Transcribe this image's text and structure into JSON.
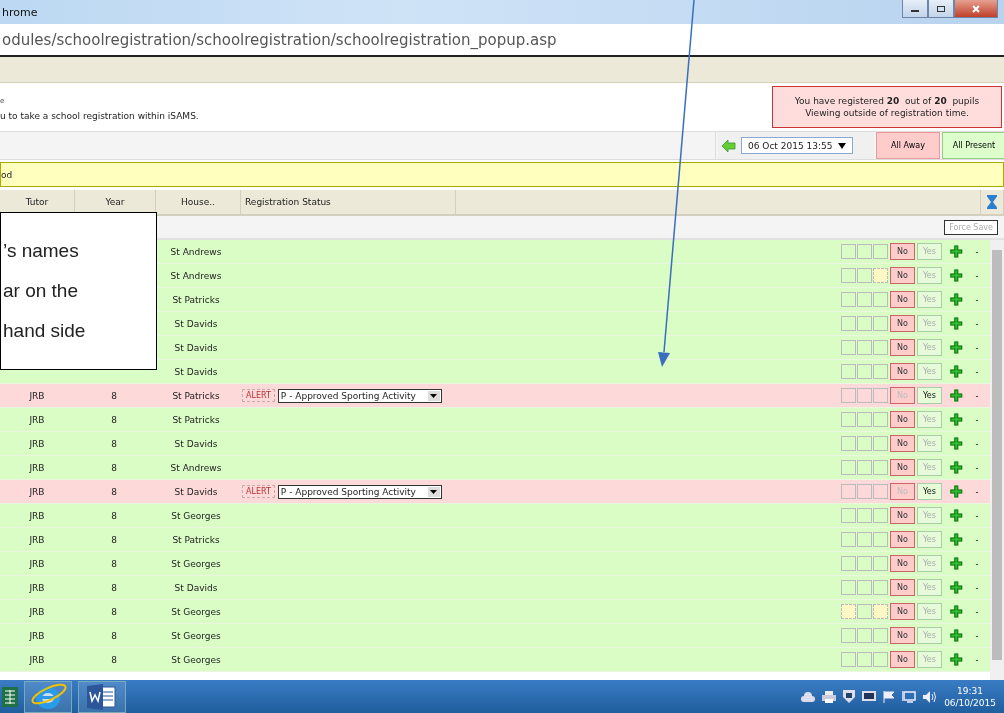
{
  "window": {
    "title": "hrome"
  },
  "address_bar": {
    "url": "odules/schoolregistration/schoolregistration/schoolregistration_popup.asp"
  },
  "intro": {
    "line_1": "e",
    "line_2": "u to take a school registration within iSAMS."
  },
  "notice": {
    "line_1": "You have registered **20**  out of **20**  pupils",
    "line_2": "Viewing outside of registration time."
  },
  "filter": {
    "date": "06 Oct 2015 13:55",
    "all_away": "All Away",
    "all_present": "All Present"
  },
  "info_bar": {
    "text": "od"
  },
  "table": {
    "columns": [
      "Tutor",
      "Year",
      "House..",
      "Registration Status"
    ],
    "force_save": "Force Save",
    "rows": [
      {
        "house": "St Andrews",
        "alert": false,
        "present": false,
        "boxes": [
          false,
          false,
          false
        ],
        "no": "No",
        "yes": "Yes",
        "add": "✚",
        "remove": "-"
      },
      {
        "house": "St Andrews",
        "alert": false,
        "present": false,
        "boxes": [
          false,
          false,
          true
        ],
        "no": "No",
        "yes": "Yes",
        "add": "✚",
        "remove": "-"
      },
      {
        "house": "St Patricks",
        "alert": false,
        "present": false,
        "boxes": [
          false,
          false,
          false
        ],
        "no": "No",
        "yes": "Yes",
        "add": "✚",
        "remove": "-"
      },
      {
        "house": "St Davids",
        "alert": false,
        "present": false,
        "boxes": [
          false,
          false,
          false
        ],
        "no": "No",
        "yes": "Yes",
        "add": "✚",
        "remove": "-"
      },
      {
        "house": "St Davids",
        "alert": false,
        "present": false,
        "boxes": [
          false,
          false,
          false
        ],
        "no": "No",
        "yes": "Yes",
        "add": "✚",
        "remove": "-"
      },
      {
        "house": "St Davids",
        "alert": false,
        "present": false,
        "boxes": [
          false,
          false,
          false
        ],
        "no": "No",
        "yes": "Yes",
        "add": "✚",
        "remove": "-"
      },
      {
        "tutor": "JRB",
        "year": "8",
        "house": "St Patricks",
        "alert": true,
        "alert_label": "ALERT",
        "status": "P - Approved Sporting Activity",
        "present": true,
        "boxes": [
          false,
          false,
          false
        ],
        "no": "No",
        "yes": "Yes",
        "add": "✚",
        "remove": "-"
      },
      {
        "tutor": "JRB",
        "year": "8",
        "house": "St Patricks",
        "alert": false,
        "present": false,
        "boxes": [
          false,
          false,
          false
        ],
        "no": "No",
        "yes": "Yes",
        "add": "✚",
        "remove": "-"
      },
      {
        "tutor": "JRB",
        "year": "8",
        "house": "St Davids",
        "alert": false,
        "present": false,
        "boxes": [
          false,
          false,
          false
        ],
        "no": "No",
        "yes": "Yes",
        "add": "✚",
        "remove": "-"
      },
      {
        "tutor": "JRB",
        "year": "8",
        "house": "St Andrews",
        "alert": false,
        "present": false,
        "boxes": [
          false,
          false,
          false
        ],
        "no": "No",
        "yes": "Yes",
        "add": "✚",
        "remove": "-"
      },
      {
        "tutor": "JRB",
        "year": "8",
        "house": "St Davids",
        "alert": true,
        "alert_label": "ALERT",
        "status": "P - Approved Sporting Activity",
        "present": true,
        "boxes": [
          false,
          false,
          false
        ],
        "no": "No",
        "yes": "Yes",
        "add": "✚",
        "remove": "-"
      },
      {
        "tutor": "JRB",
        "year": "8",
        "house": "St Georges",
        "alert": false,
        "present": false,
        "boxes": [
          false,
          false,
          false
        ],
        "no": "No",
        "yes": "Yes",
        "add": "✚",
        "remove": "-"
      },
      {
        "tutor": "JRB",
        "year": "8",
        "house": "St Patricks",
        "alert": false,
        "present": false,
        "boxes": [
          false,
          false,
          false
        ],
        "no": "No",
        "yes": "Yes",
        "add": "✚",
        "remove": "-"
      },
      {
        "tutor": "JRB",
        "year": "8",
        "house": "St Georges",
        "alert": false,
        "present": false,
        "boxes": [
          false,
          false,
          false
        ],
        "no": "No",
        "yes": "Yes",
        "add": "✚",
        "remove": "-"
      },
      {
        "tutor": "JRB",
        "year": "8",
        "house": "St Davids",
        "alert": false,
        "present": false,
        "boxes": [
          false,
          false,
          false
        ],
        "no": "No",
        "yes": "Yes",
        "add": "✚",
        "remove": "-"
      },
      {
        "tutor": "JRB",
        "year": "8",
        "house": "St Georges",
        "alert": false,
        "present": false,
        "boxes": [
          true,
          false,
          true
        ],
        "no": "No",
        "yes": "Yes",
        "add": "✚",
        "remove": "-"
      },
      {
        "tutor": "JRB",
        "year": "8",
        "house": "St Georges",
        "alert": false,
        "present": false,
        "boxes": [
          false,
          false,
          false
        ],
        "no": "No",
        "yes": "Yes",
        "add": "✚",
        "remove": "-"
      },
      {
        "tutor": "JRB",
        "year": "8",
        "house": "St Georges",
        "alert": false,
        "present": false,
        "boxes": [
          false,
          false,
          false
        ],
        "no": "No",
        "yes": "Yes",
        "add": "✚",
        "remove": "-"
      }
    ]
  },
  "callout": {
    "lines": [
      "’s names",
      "ar on the",
      "hand side"
    ]
  },
  "taskbar": {
    "time": "19:31",
    "date": "06/10/2015"
  }
}
